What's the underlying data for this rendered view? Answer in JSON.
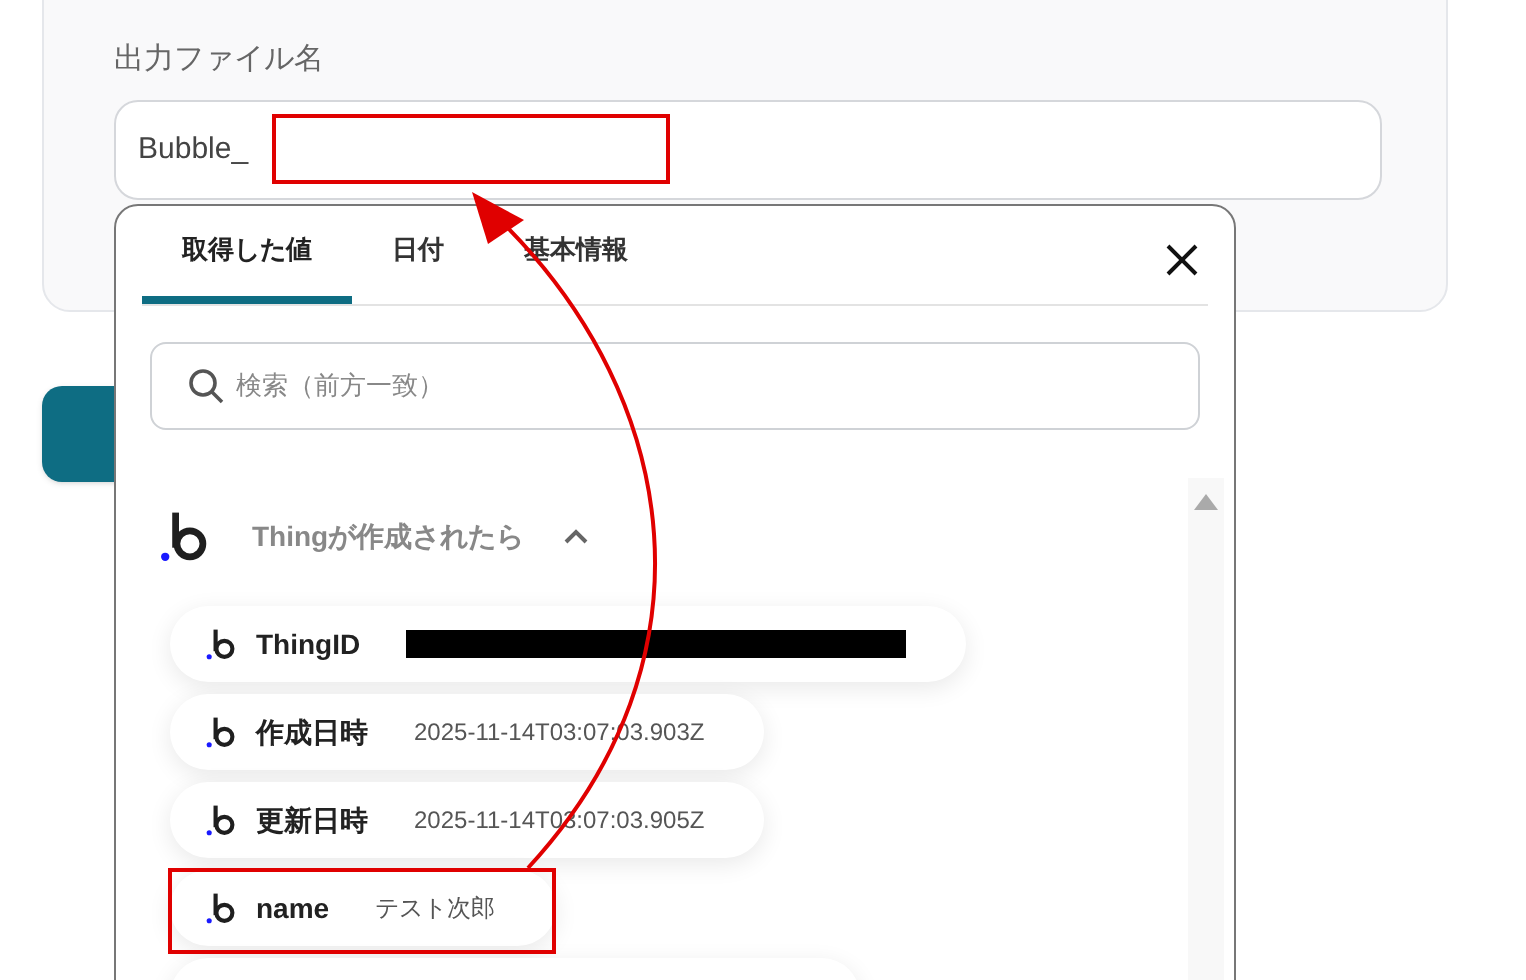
{
  "field": {
    "label": "出力ファイル名",
    "value": "Bubble_"
  },
  "popup": {
    "tabs": [
      {
        "label": "取得した値",
        "selected": true
      },
      {
        "label": "日付",
        "selected": false
      },
      {
        "label": "基本情報",
        "selected": false
      }
    ],
    "search": {
      "placeholder": "検索（前方一致）"
    },
    "group": {
      "title": "Thingが作成されたら",
      "expanded": true,
      "items": [
        {
          "name": "ThingID",
          "redacted": true
        },
        {
          "name": "作成日時",
          "value": "2025-11-14T03:07:03.903Z",
          "redacted": false
        },
        {
          "name": "更新日時",
          "value": "2025-11-14T03:07:03.905Z",
          "redacted": false
        },
        {
          "name": "name",
          "value": "テスト次郎",
          "redacted": false
        }
      ]
    }
  }
}
